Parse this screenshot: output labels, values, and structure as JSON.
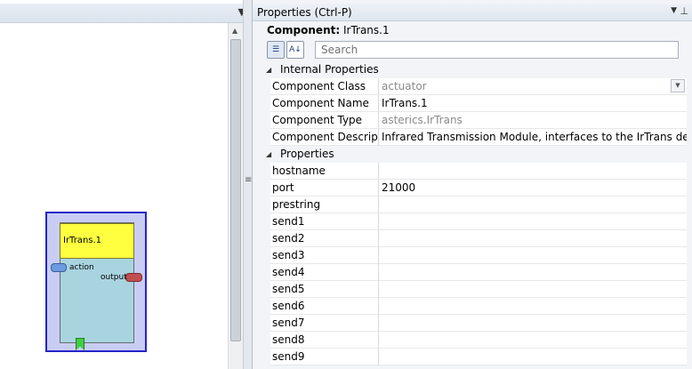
{
  "properties_panel": {
    "title": "Properties (Ctrl-P)",
    "component_label": "Component:",
    "component_value": "IrTrans.1",
    "search_placeholder": "Search",
    "categories": [
      {
        "label": "Internal Properties",
        "rows": [
          {
            "name": "Component Class",
            "value": "actuator"
          },
          {
            "name": "Component Name",
            "value": "IrTrans.1"
          },
          {
            "name": "Component Type",
            "value": "asterics.IrTrans"
          },
          {
            "name": "Component Descriptic",
            "value": "Infrared Transmission Module, interfaces to the IrTrans device"
          }
        ]
      },
      {
        "label": "Properties",
        "rows": [
          {
            "name": "hostname",
            "value": ""
          },
          {
            "name": "port",
            "value": "21000"
          },
          {
            "name": "prestring",
            "value": ""
          },
          {
            "name": "send1",
            "value": ""
          },
          {
            "name": "send2",
            "value": ""
          },
          {
            "name": "send3",
            "value": ""
          },
          {
            "name": "send4",
            "value": ""
          },
          {
            "name": "send5",
            "value": ""
          },
          {
            "name": "send6",
            "value": ""
          },
          {
            "name": "send7",
            "value": ""
          },
          {
            "name": "send8",
            "value": ""
          },
          {
            "name": "send9",
            "value": ""
          }
        ]
      }
    ]
  },
  "canvas": {
    "component": {
      "title": "IrTrans.1",
      "input_port": "action",
      "output_port": "output"
    }
  },
  "colors": {
    "component_border": "#2424c8",
    "component_fill": "#c9cdf4",
    "title_fill": "#ffff40",
    "body_fill": "#a8d4e0",
    "input_port": "#6d9be0",
    "output_port": "#c05050",
    "event_port": "#44cc44"
  },
  "icons": {
    "categorized_sort": "categorized-icon",
    "alphabetical_sort": "sort-az-icon",
    "dropdown": "chevron-down-icon",
    "pin": "pin-icon"
  }
}
